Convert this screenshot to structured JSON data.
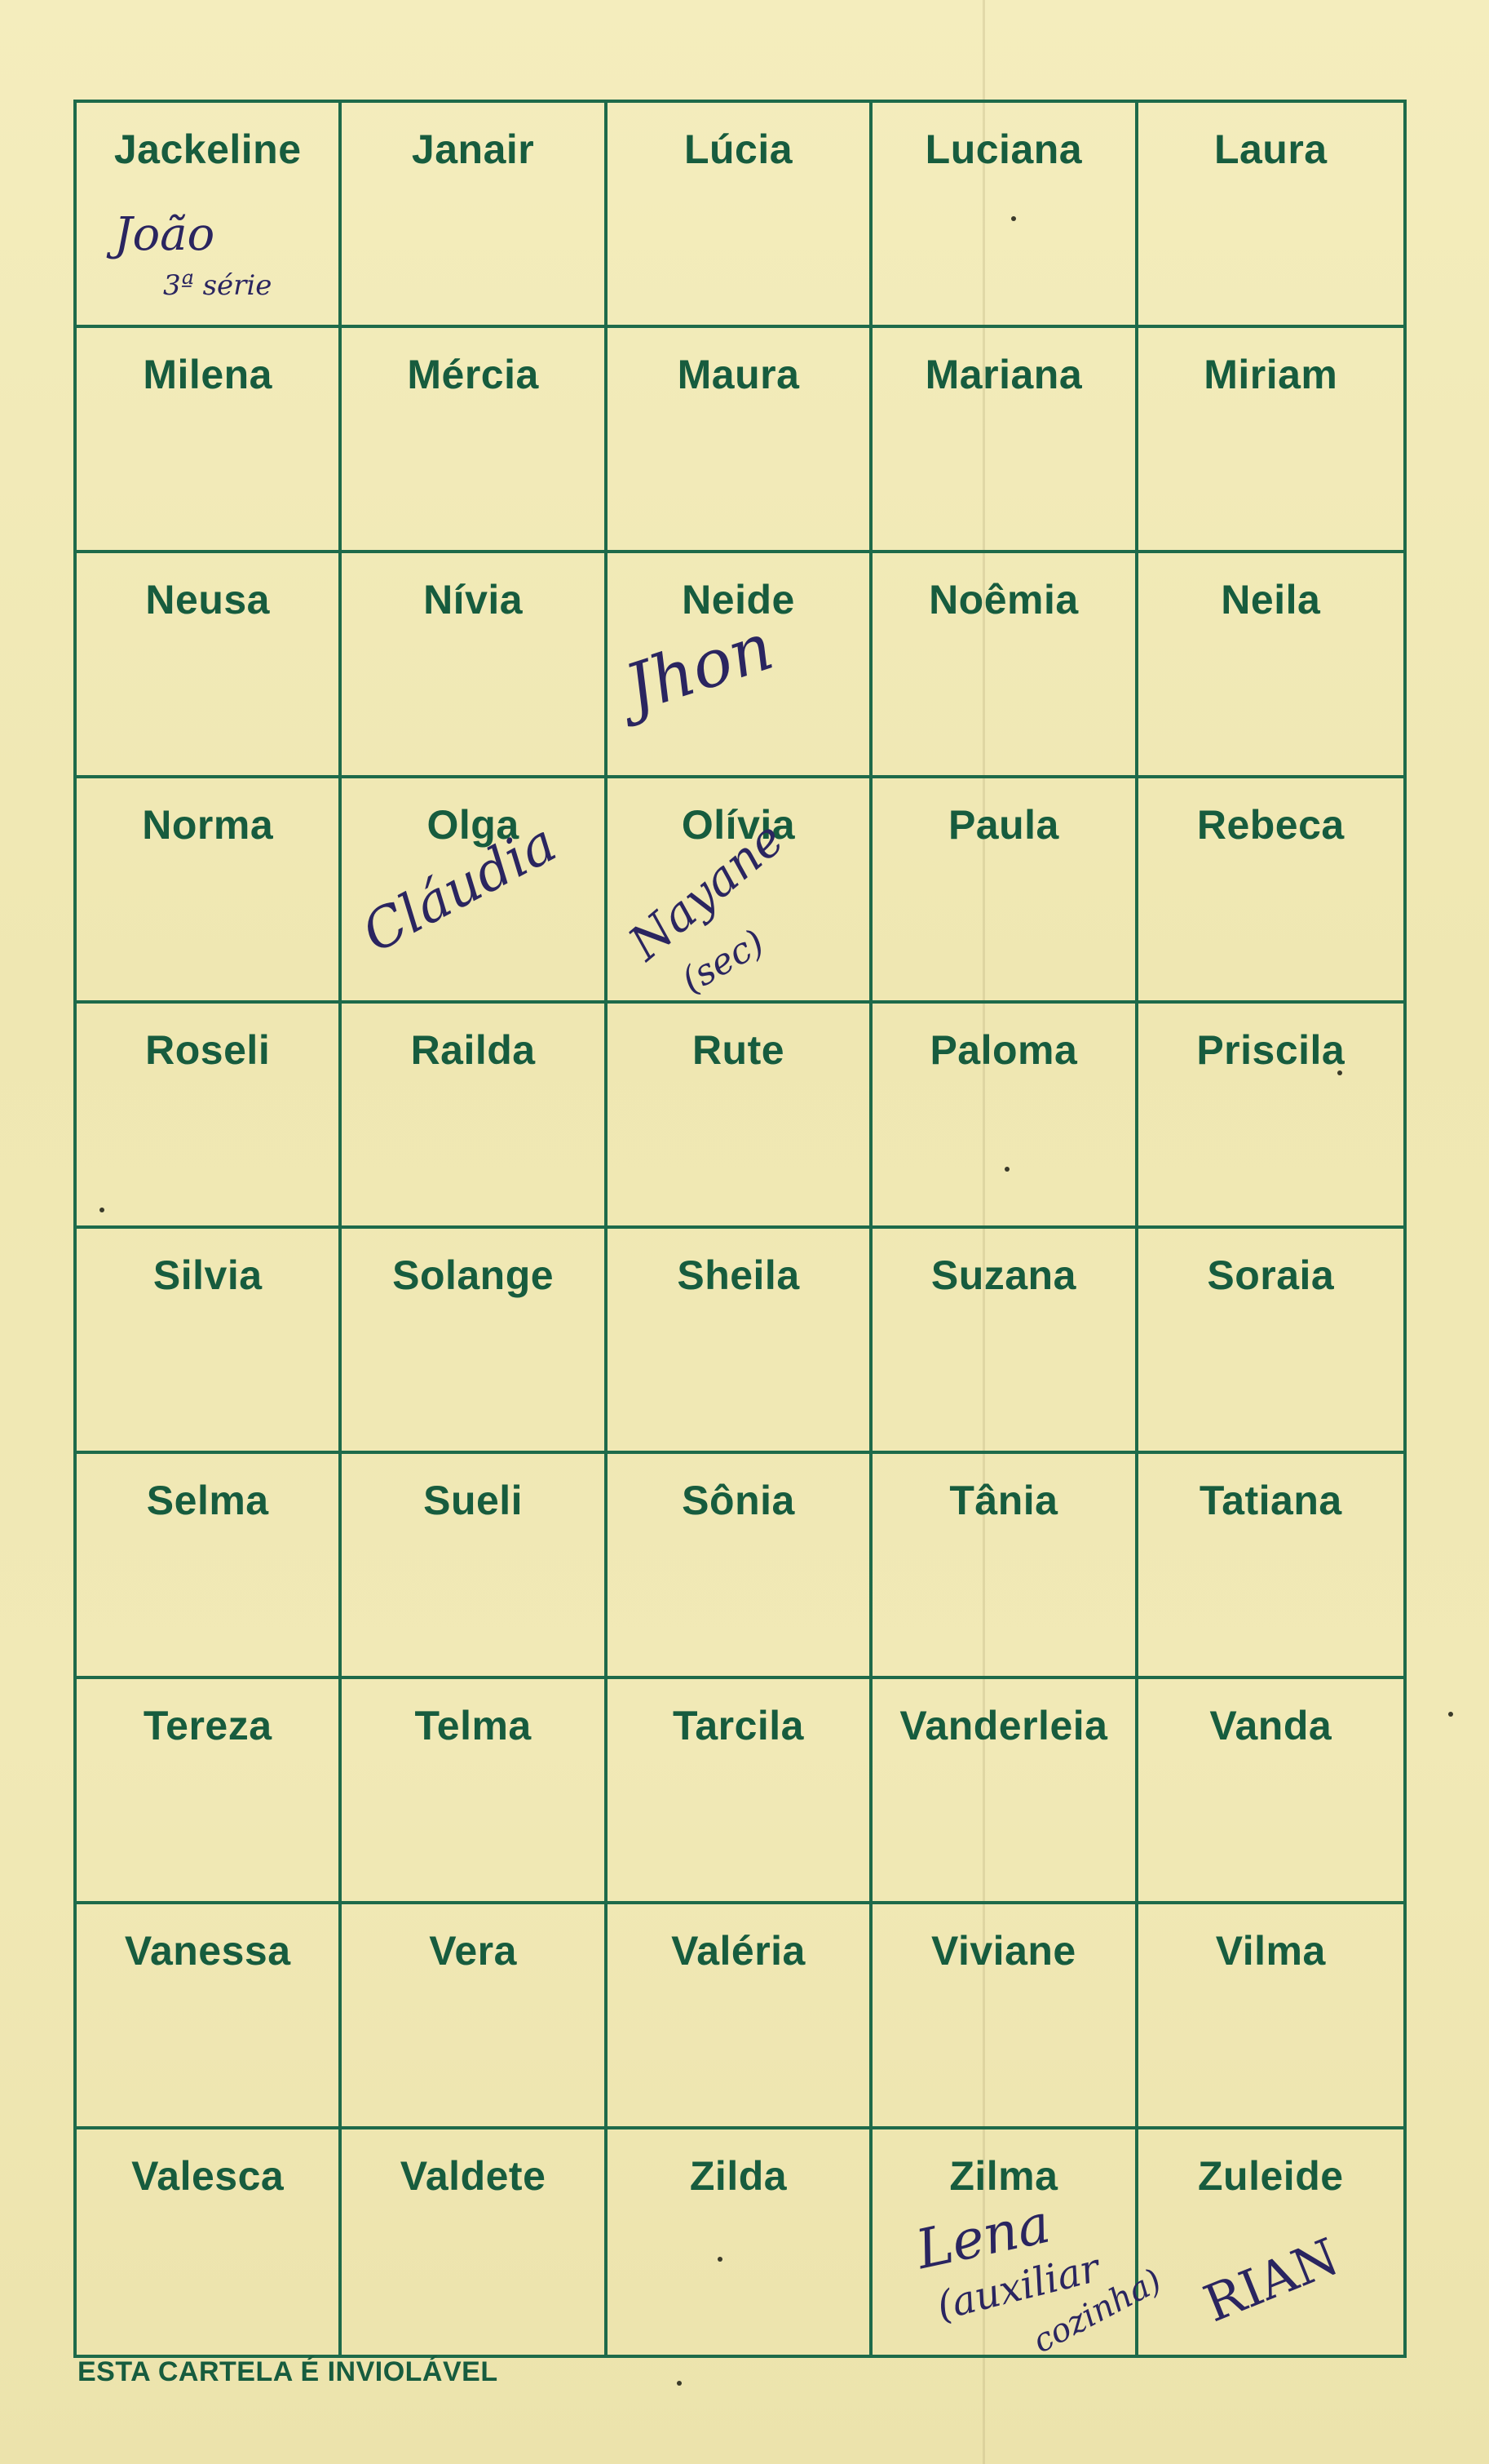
{
  "card": {
    "names": [
      "Jackeline",
      "Janair",
      "Lúcia",
      "Luciana",
      "Laura",
      "Milena",
      "Mércia",
      "Maura",
      "Mariana",
      "Miriam",
      "Neusa",
      "Nívia",
      "Neide",
      "Noêmia",
      "Neila",
      "Norma",
      "Olga",
      "Olívia",
      "Paula",
      "Rebeca",
      "Roseli",
      "Railda",
      "Rute",
      "Paloma",
      "Priscila",
      "Silvia",
      "Solange",
      "Sheila",
      "Suzana",
      "Soraia",
      "Selma",
      "Sueli",
      "Sônia",
      "Tânia",
      "Tatiana",
      "Tereza",
      "Telma",
      "Tarcila",
      "Vanderleia",
      "Vanda",
      "Vanessa",
      "Vera",
      "Valéria",
      "Viviane",
      "Vilma",
      "Valesca",
      "Valdete",
      "Zilda",
      "Zilma",
      "Zuleide"
    ],
    "footer": "ESTA CARTELA É INVIOLÁVEL"
  },
  "handwriting": {
    "jackeline_line1": "João",
    "jackeline_line2": "3ª série",
    "neide": "Jhon",
    "olga": "Cláudia",
    "olivia_line1": "Nayane",
    "olivia_line2": "(sec)",
    "zilma_line1": "Lena",
    "zilma_line2": "(auxiliar",
    "zilma_line3": "cozinha)",
    "zuleide": "RIAN"
  },
  "colors": {
    "ink_green": "#175c3e",
    "grid_green": "#1e6a4a",
    "pen_blue": "#2a2560",
    "paper": "#f2eab6"
  }
}
